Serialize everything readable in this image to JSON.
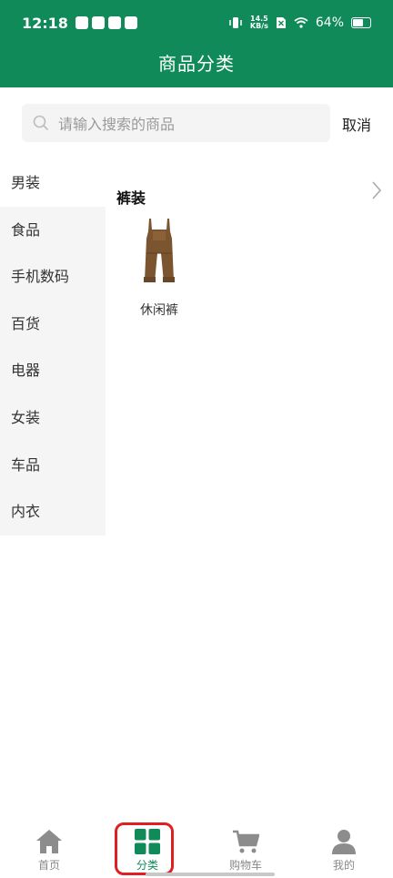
{
  "status_bar": {
    "time": "12:18",
    "net_speed_value": "14.5",
    "net_speed_unit": "KB/s",
    "battery_percent": "64%",
    "battery_level": 0.64
  },
  "header": {
    "title": "商品分类"
  },
  "search": {
    "placeholder": "请输入搜索的商品",
    "cancel_label": "取消"
  },
  "sidebar": {
    "items": [
      {
        "label": "男装"
      },
      {
        "label": "食品"
      },
      {
        "label": "手机数码"
      },
      {
        "label": "百货"
      },
      {
        "label": "电器"
      },
      {
        "label": "女装"
      },
      {
        "label": "车品"
      },
      {
        "label": "内衣"
      }
    ],
    "active_index": 0
  },
  "content": {
    "section_title": "裤装",
    "products": [
      {
        "label": "休闲裤"
      }
    ]
  },
  "bottom_nav": {
    "items": [
      {
        "label": "首页",
        "icon": "home-icon"
      },
      {
        "label": "分类",
        "icon": "category-grid-icon"
      },
      {
        "label": "购物车",
        "icon": "cart-icon"
      },
      {
        "label": "我的",
        "icon": "user-icon"
      }
    ],
    "active_index": 1
  },
  "colors": {
    "brand": "#0f8a58",
    "highlight": "#e02020",
    "inactive": "#888888"
  }
}
